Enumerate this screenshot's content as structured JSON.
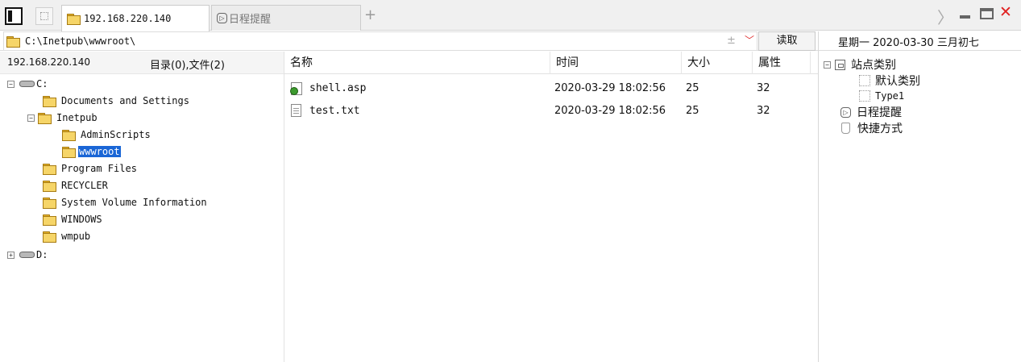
{
  "tabs": {
    "active_label": "192.168.220.140",
    "reminder_label": "日程提醒",
    "add": "+",
    "next": "〉"
  },
  "address": {
    "path": "C:\\Inetpub\\wwwroot\\",
    "read_label": "读取"
  },
  "date_display": "星期一 2020-03-30 三月初七",
  "left_panel": {
    "server": "192.168.220.140",
    "stats": "目录(0),文件(2)",
    "tree": [
      {
        "label": "C:",
        "expander": "−"
      },
      {
        "label": "Documents and Settings"
      },
      {
        "label": "Inetpub",
        "expander": "−"
      },
      {
        "label": "AdminScripts"
      },
      {
        "label": "wwwroot",
        "selected": true
      },
      {
        "label": "Program Files"
      },
      {
        "label": "RECYCLER"
      },
      {
        "label": "System Volume Information"
      },
      {
        "label": "WINDOWS"
      },
      {
        "label": "wmpub"
      },
      {
        "label": "D:",
        "expander": "+"
      }
    ]
  },
  "files": {
    "headers": [
      "名称",
      "时间",
      "大小",
      "属性"
    ],
    "rows": [
      {
        "name": "shell.asp",
        "time": "2020-03-29 18:02:56",
        "size": "25",
        "attr": "32",
        "icon": "asp-file-icon"
      },
      {
        "name": "test.txt",
        "time": "2020-03-29 18:02:56",
        "size": "25",
        "attr": "32",
        "icon": "text-file-icon"
      }
    ]
  },
  "sites": {
    "root": "站点类别",
    "root_expander": "−",
    "categories": [
      "默认类别",
      "Type1"
    ],
    "reminder": "日程提醒",
    "shortcuts": "快捷方式"
  },
  "colors": {
    "selection": "#1a66d6",
    "close": "#e02020",
    "folder": "#f6d568"
  }
}
